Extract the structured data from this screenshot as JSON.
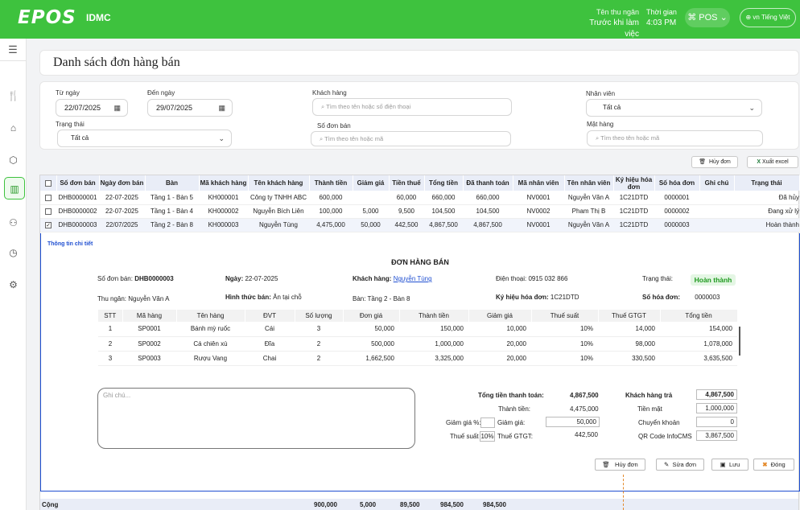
{
  "header": {
    "logo": "EPOS",
    "company": "IDMC",
    "cashier_label": "Tên thu ngân",
    "cashier_value": "Trước khi làm việc",
    "time_label": "Thời gian",
    "time_value": "4:03 PM",
    "pos_button": "POS",
    "lang_button": "Tiếng Việt",
    "lang_flag": "vn"
  },
  "sidebar": {
    "items": [
      "menu-icon",
      "utensils-icon",
      "home-icon",
      "box-icon",
      "chart-icon",
      "users-icon",
      "clock-icon",
      "settings-icon"
    ]
  },
  "page_title": "Danh sách đơn hàng bán",
  "filters": {
    "from_date_label": "Từ ngày",
    "from_date": "22/07/2025",
    "to_date_label": "Đến ngày",
    "to_date": "29/07/2025",
    "customer_label": "Khách hàng",
    "customer_placeholder": "Tìm theo tên hoặc số điện thoại",
    "staff_label": "Nhân viên",
    "staff_value": "Tất cả",
    "status_label": "Trạng thái",
    "status_value": "Tất cả",
    "order_no_label": "Số đơn bán",
    "order_no_placeholder": "Tìm theo tên hoặc mã",
    "item_label": "Mặt hàng",
    "item_placeholder": "Tìm theo tên hoặc mã"
  },
  "actions": {
    "cancel_order": "Hủy đơn",
    "export_excel": "Xuất excel"
  },
  "table": {
    "columns": [
      "",
      "Số đơn bán",
      "Ngày đơn bán",
      "Bàn",
      "Mã khách hàng",
      "Tên khách hàng",
      "Thành tiền",
      "Giảm giá",
      "Tiền thuế",
      "Tổng tiền",
      "Đã thanh toán",
      "Mã nhân viên",
      "Tên nhân viên",
      "Ký hiệu hóa đơn",
      "Số hóa đơn",
      "Ghi chú",
      "Trạng thái"
    ],
    "rows": [
      {
        "check": "",
        "cells": [
          "DHB0000001",
          "22-07-2025",
          "Tầng 1 - Bàn 5",
          "KH000001",
          "Công ty TNHH ABC",
          "600,000",
          "",
          "60,000",
          "660,000",
          "660,000",
          "NV0001",
          "Nguyễn Văn A",
          "1C21DTD",
          "0000001",
          "",
          "Đã hủy"
        ]
      },
      {
        "check": "",
        "cells": [
          "DHB0000002",
          "22-07-2025",
          "Tầng 1 - Bàn 4",
          "KH000002",
          "Nguyễn Bích Liên",
          "100,000",
          "5,000",
          "9,500",
          "104,500",
          "104,500",
          "NV0002",
          "Pham Thị B",
          "1C21DTD",
          "0000002",
          "",
          "Đang xử lý"
        ]
      },
      {
        "check": "✓",
        "cells": [
          "DHB0000003",
          "22/07/2025",
          "Tầng 2 - Bàn 8",
          "KH000003",
          "Nguyễn Tùng",
          "4,475,000",
          "50,000",
          "442,500",
          "4,867,500",
          "4,867,500",
          "NV0001",
          "Nguyễn Văn A",
          "1C21DTD",
          "0000003",
          "",
          "Hoàn thành"
        ]
      }
    ],
    "total": {
      "label": "Cộng",
      "amount": "900,000",
      "discount": "5,000",
      "tax": "89,500",
      "total": "984,500",
      "paid": "984,500"
    }
  },
  "detail": {
    "tab": "Thông tin chi tiết",
    "title": "ĐƠN HÀNG BÁN",
    "order_no_label": "Số đơn bán:",
    "order_no": "DHB0000003",
    "date_label": "Ngày:",
    "date": "22-07-2025",
    "customer_label": "Khách hàng:",
    "customer": "Nguyễn Tùng",
    "phone_label": "Điện thoại:",
    "phone": "0915 032 866",
    "status_label": "Trạng thái:",
    "status": "Hoàn thành",
    "cashier_label": "Thu ngân:",
    "cashier": "Nguyễn Văn A",
    "sale_type_label": "Hình thức bán:",
    "sale_type": "Ăn tại chỗ",
    "table_label": "Bàn:",
    "table": "Tầng 2 - Bàn 8",
    "invoice_symbol_label": "Ký hiệu hóa đơn:",
    "invoice_symbol": "1C21DTD",
    "invoice_no_label": "Số hóa đơn:",
    "invoice_no": "0000003",
    "item_columns": [
      "STT",
      "Mã hàng",
      "Tên hàng",
      "ĐVT",
      "Số lượng",
      "Đơn giá",
      "Thành tiền",
      "Giảm giá",
      "Thuế suất",
      "Thuế GTGT",
      "Tổng tiền"
    ],
    "items": [
      [
        "1",
        "SP0001",
        "Bánh mỳ ruốc",
        "Cái",
        "3",
        "50,000",
        "150,000",
        "10,000",
        "10%",
        "14,000",
        "154,000"
      ],
      [
        "2",
        "SP0002",
        "Cá chiên xù",
        "Đĩa",
        "2",
        "500,000",
        "1,000,000",
        "20,000",
        "10%",
        "98,000",
        "1,078,000"
      ],
      [
        "3",
        "SP0003",
        "Rượu Vang",
        "Chai",
        "2",
        "1,662,500",
        "3,325,000",
        "20,000",
        "10%",
        "330,500",
        "3,635,500"
      ]
    ],
    "note_placeholder": "Ghi chú...",
    "totals": {
      "total_payment_label": "Tổng tiền thanh toán:",
      "total_payment": "4,867,500",
      "subtotal_label": "Thành tiền:",
      "subtotal": "4,475,000",
      "discount_pct_label": "Giảm giá %:",
      "discount_pct": "",
      "discount_label": "Giảm giá:",
      "discount": "50,000",
      "tax_rate_label": "Thuế suất",
      "tax_rate": "10%",
      "vat_label": "Thuế GTGT:",
      "vat": "442,500",
      "customer_paid_label": "Khách hàng trả",
      "customer_paid": "4,867,500",
      "cash_label": "Tiền mặt",
      "cash": "1,000,000",
      "transfer_label": "Chuyển khoản",
      "transfer": "0",
      "qr_label": "QR Code InfoCMS",
      "qr": "3,867,500"
    },
    "buttons": {
      "cancel": "Hủy đơn",
      "edit": "Sửa đơn",
      "save": "Lưu",
      "close": "Đóng"
    }
  }
}
